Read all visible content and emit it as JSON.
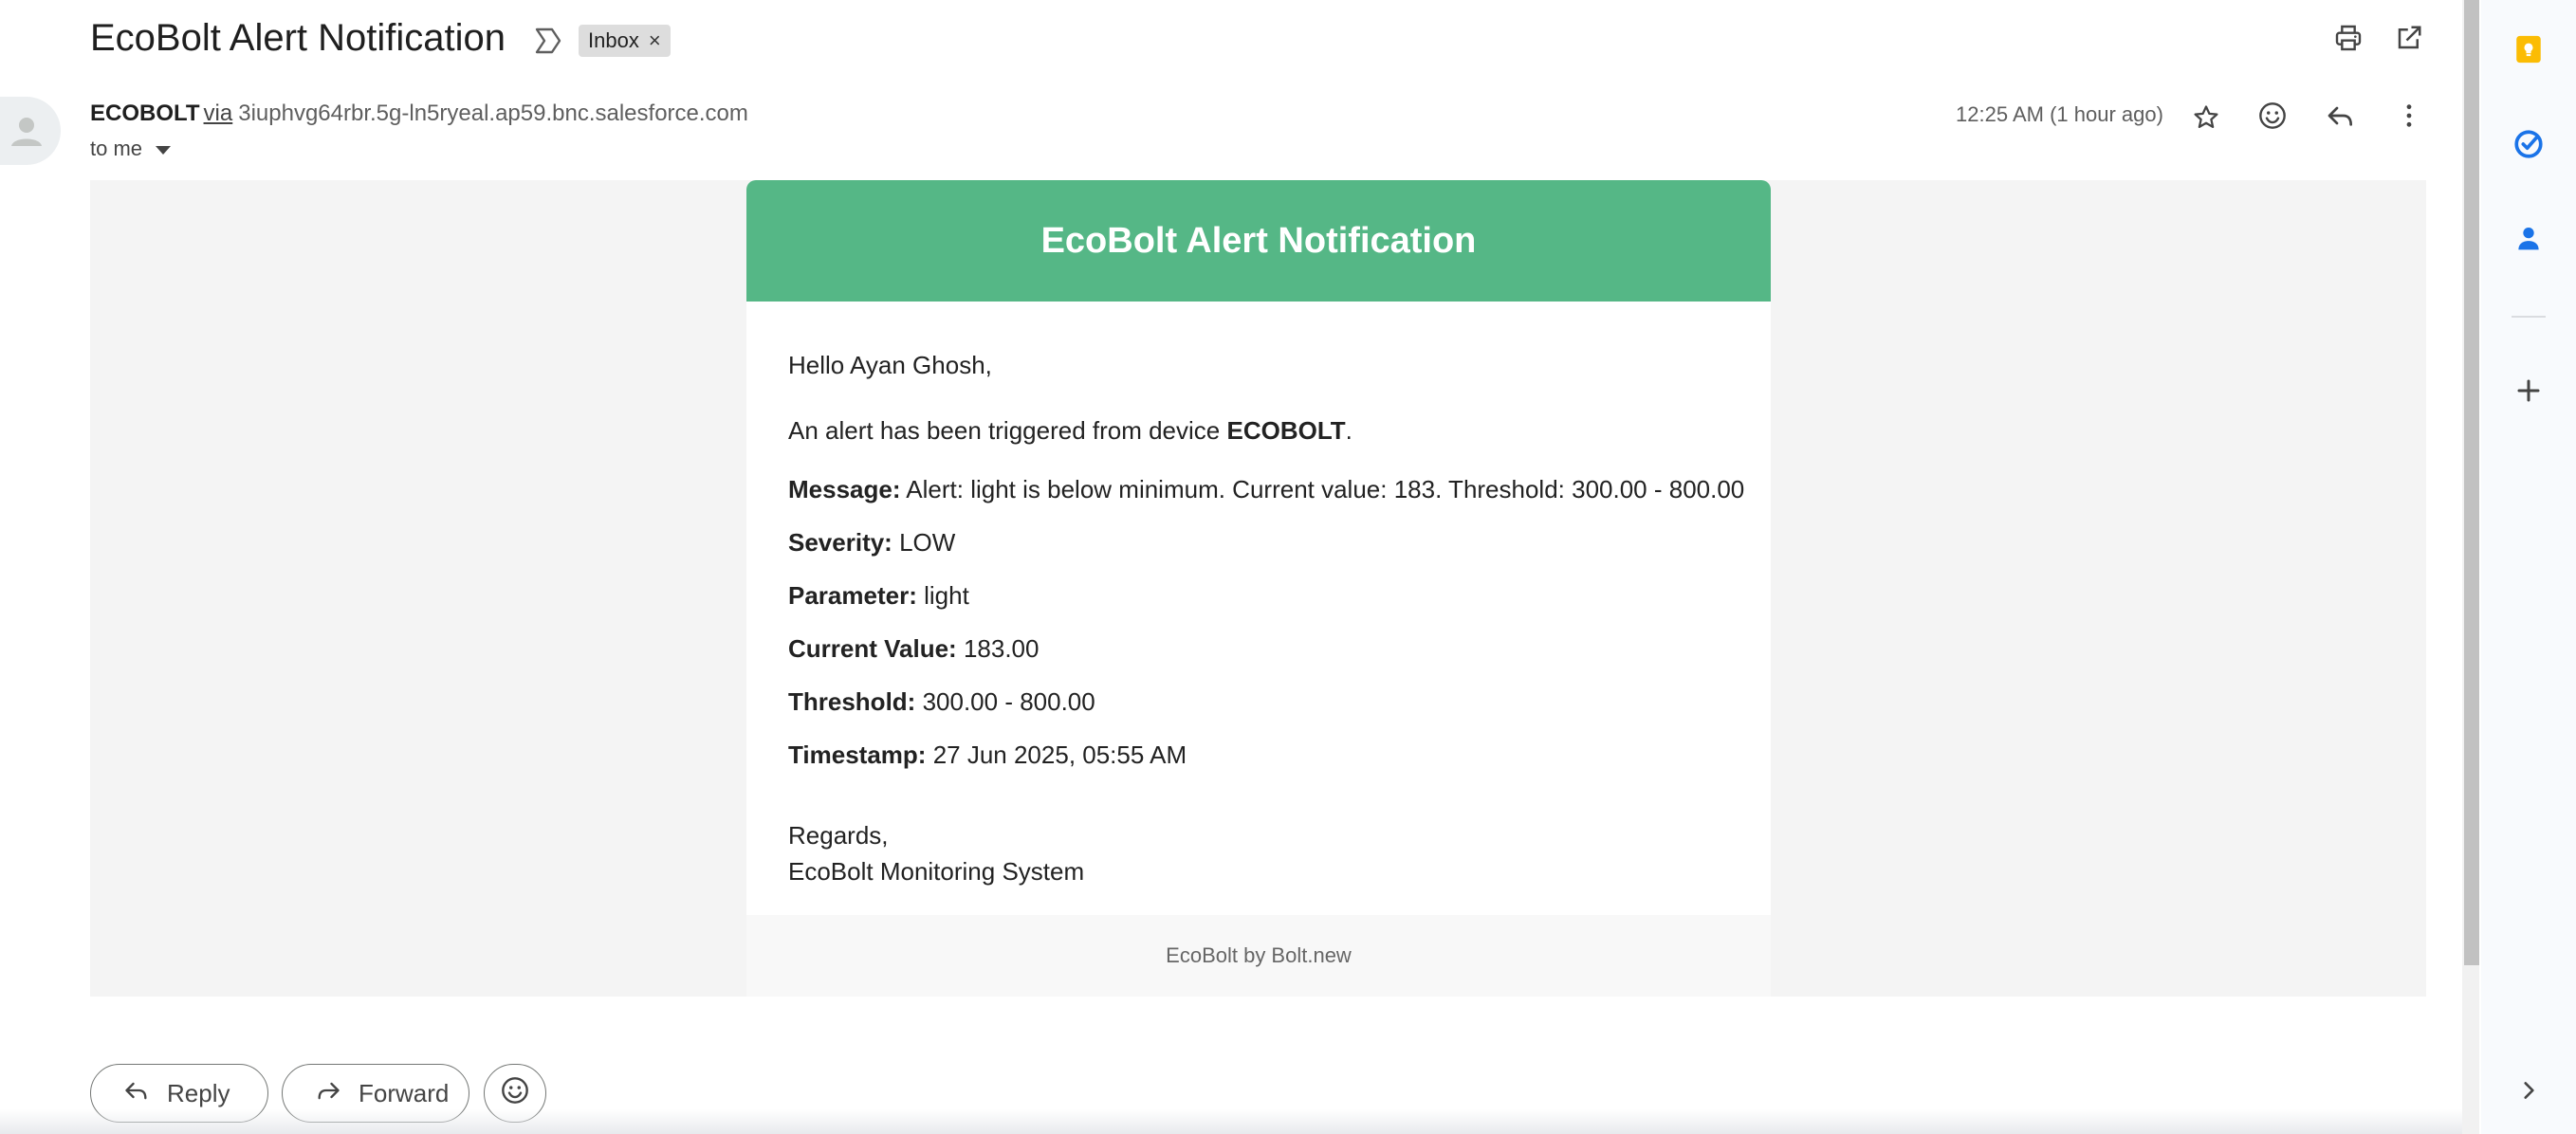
{
  "email": {
    "subject": "EcoBolt Alert Notification",
    "label": "Inbox",
    "label_remove": "×",
    "sender_name": "ECOBOLT",
    "via": "via",
    "sender_address": "3iuphvg64rbr.5g-ln5ryeal.ap59.bnc.salesforce.com",
    "recipient": "to me",
    "datetime": "12:25 AM (1 hour ago)"
  },
  "card": {
    "header": "EcoBolt Alert Notification",
    "greeting": "Hello Ayan Ghosh,",
    "intro_prefix": "An alert has been triggered from device ",
    "intro_device": "ECOBOLT",
    "intro_suffix": ".",
    "fields": [
      {
        "label": "Message:",
        "value": "Alert: light is below minimum. Current value: 183. Threshold: 300.00 - 800.00"
      },
      {
        "label": "Severity:",
        "value": "LOW"
      },
      {
        "label": "Parameter:",
        "value": "light"
      },
      {
        "label": "Current Value:",
        "value": "183.00"
      },
      {
        "label": "Threshold:",
        "value": "300.00 - 800.00"
      },
      {
        "label": "Timestamp:",
        "value": "27 Jun 2025, 05:55 AM"
      }
    ],
    "regards": "Regards,",
    "signature": "EcoBolt Monitoring System",
    "footer": "EcoBolt by Bolt.new"
  },
  "actions": {
    "reply": "Reply",
    "forward": "Forward"
  },
  "icons": {
    "importance": "label-important-outline-icon",
    "print": "print-icon",
    "open_new_window": "open-in-new-icon",
    "star": "star-outline-icon",
    "emoji": "emoji-reaction-icon",
    "reply": "reply-icon",
    "more": "more-vert-icon",
    "keep": "keep-icon",
    "tasks": "tasks-icon",
    "contacts": "contacts-icon",
    "add": "add-icon",
    "expand": "chevron-right-icon"
  },
  "colors": {
    "card_header": "#55b786",
    "body_background": "#f4f4f4",
    "keep_yellow": "#fbbc04",
    "tasks_blue": "#1a73e8",
    "contacts_blue": "#1a73e8"
  }
}
